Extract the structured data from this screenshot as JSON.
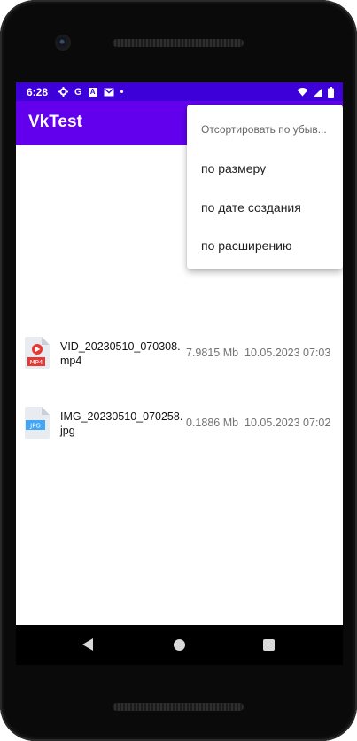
{
  "status_bar": {
    "time": "6:28",
    "icons": [
      "gear-icon",
      "google-g-icon",
      "a-badge-icon",
      "gmail-icon",
      "dot-icon",
      "wifi-icon",
      "cell-signal-icon",
      "battery-icon"
    ],
    "g_glyph": "G",
    "a_glyph": "A",
    "dot_glyph": "•"
  },
  "app_bar": {
    "title": "VkTest",
    "color": "#6200ee",
    "status_color": "#3d00d8"
  },
  "files": [
    {
      "name": "VID_20230510_070308.mp4",
      "size": "7.9815 Mb",
      "date": "10.05.2023 07:03",
      "type_badge": "MP4",
      "badge_color": "#e53935"
    },
    {
      "name": "IMG_20230510_070258.jpg",
      "size": "0.1886 Mb",
      "date": "10.05.2023 07:02",
      "type_badge": "JPG",
      "badge_color": "#42a5f5"
    }
  ],
  "sort_menu": {
    "header": "Отсортировать по убыв...",
    "items": [
      "по размеру",
      "по дате создания",
      "по расширению"
    ]
  }
}
